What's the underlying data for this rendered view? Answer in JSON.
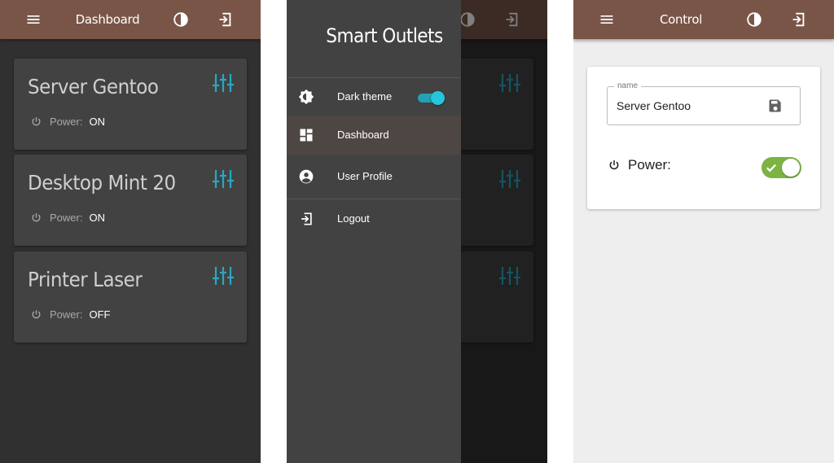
{
  "dashboard": {
    "title": "Dashboard",
    "power_label": "Power:",
    "outlets": [
      {
        "name": "Server Gentoo",
        "state": "ON"
      },
      {
        "name": "Desktop Mint 20",
        "state": "ON"
      },
      {
        "name": "Printer Laser",
        "state": "OFF"
      }
    ]
  },
  "drawer": {
    "title": "Smart Outlets",
    "items": [
      {
        "label": "Dark theme",
        "icon": "brightness-icon",
        "toggle_on": true
      },
      {
        "label": "Dashboard",
        "icon": "dashboard-icon",
        "active": true
      },
      {
        "label": "User Profile",
        "icon": "account-circle-icon"
      },
      {
        "label": "Logout",
        "icon": "logout-icon"
      }
    ]
  },
  "control": {
    "title": "Control",
    "name_label": "name",
    "name_value": "Server Gentoo",
    "power_label": "Power:",
    "power_on": true
  },
  "colors": {
    "appbar": "#795548",
    "accent": "#26c6da",
    "switch_on": "#7cb342",
    "dark_bg": "#303030",
    "card_bg": "#424242"
  },
  "icons": {
    "menu": "menu-icon",
    "contrast": "contrast-icon",
    "logout": "logout-icon",
    "tune": "tune-icon",
    "power": "power-icon",
    "save": "save-icon"
  }
}
